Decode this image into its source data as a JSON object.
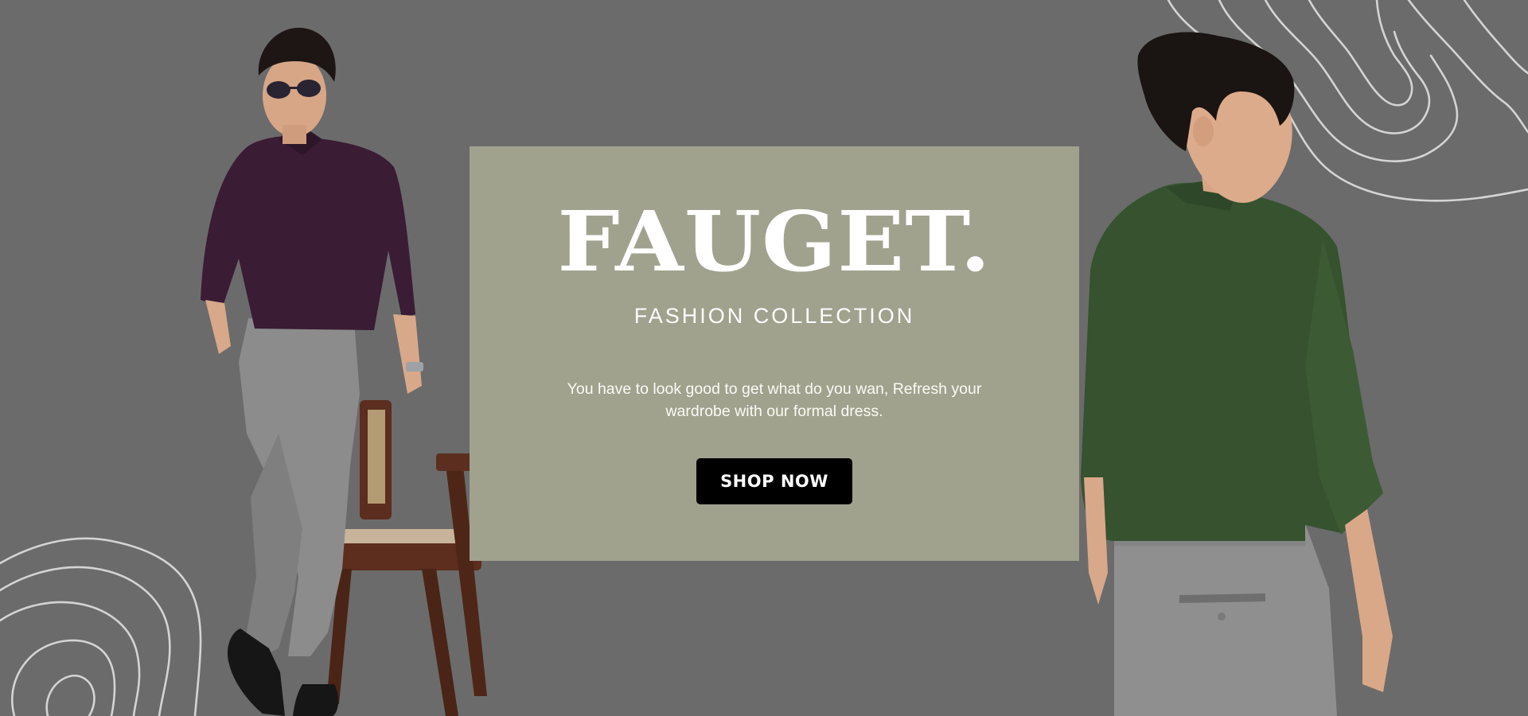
{
  "hero": {
    "brand": "FAUGET.",
    "subtitle": "FASHION COLLECTION",
    "description": "You have to look good to get what do you wan, Refresh your wardrobe with our formal dress.",
    "cta_label": "SHOP NOW"
  },
  "colors": {
    "background": "#6b6b6b",
    "card": "#a0a28e",
    "button": "#000000",
    "text": "#ffffff",
    "contour": "#d4d4d4"
  }
}
